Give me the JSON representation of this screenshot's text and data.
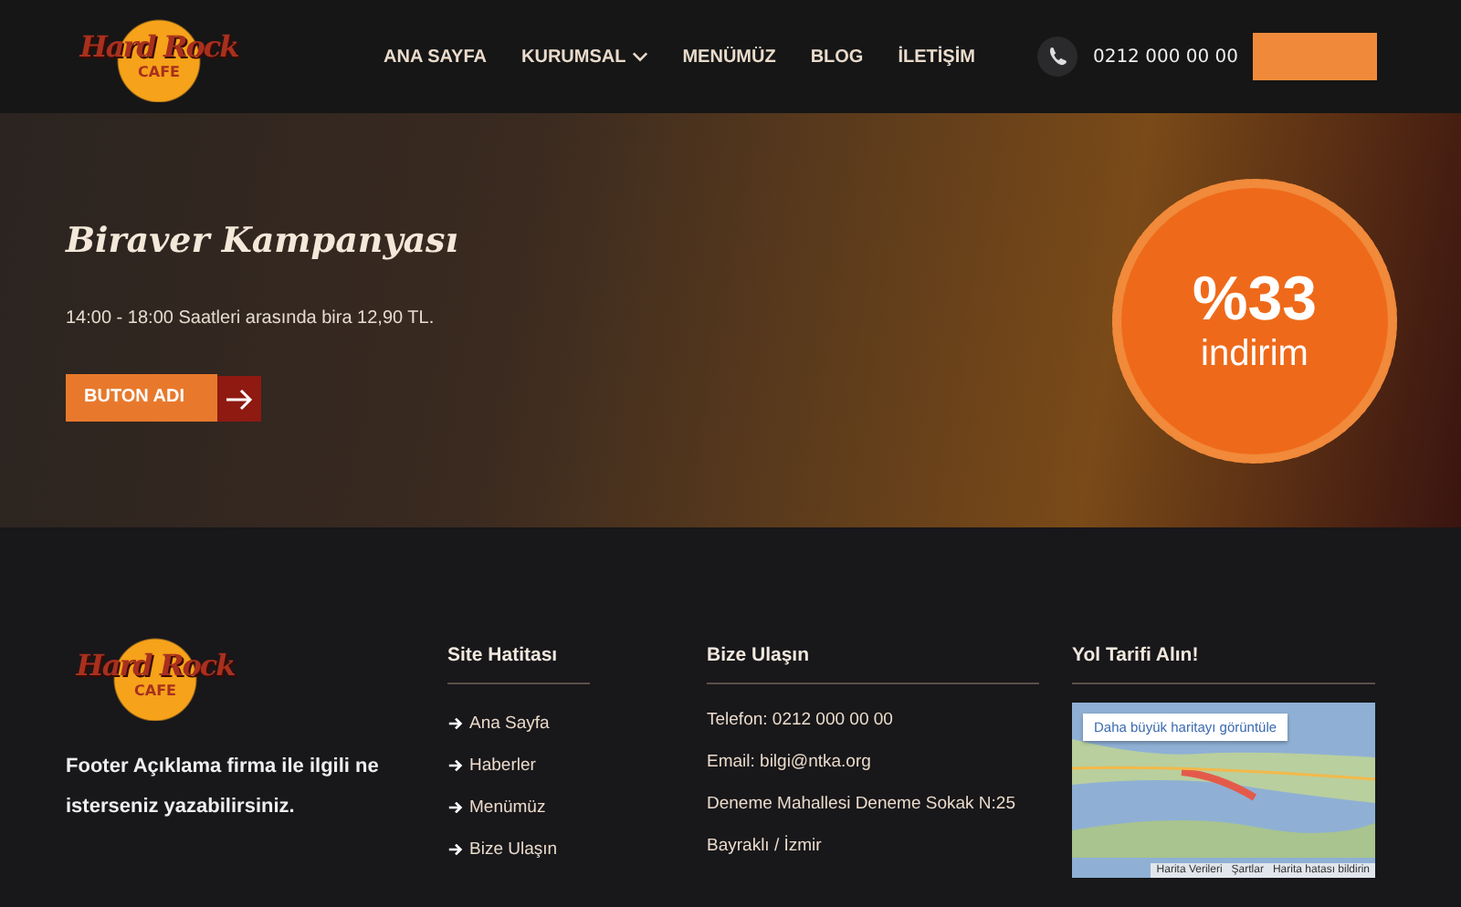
{
  "header": {
    "logo": {
      "top": "Hard Rock",
      "bottom": "CAFE"
    },
    "nav": [
      {
        "label": "ANA SAYFA",
        "dropdown": false
      },
      {
        "label": "KURUMSAL",
        "dropdown": true
      },
      {
        "label": "MENÜMÜZ",
        "dropdown": false
      },
      {
        "label": "BLOG",
        "dropdown": false
      },
      {
        "label": "İLETİŞİM",
        "dropdown": false
      }
    ],
    "phone": "0212 000 00 00"
  },
  "hero": {
    "title": "Biraver Kampanyası",
    "text": "14:00 - 18:00 Saatleri arasında bira 12,90 TL.",
    "button": "BUTON ADI",
    "badge": {
      "value": "%33",
      "label": "indirim"
    }
  },
  "footer": {
    "logo": {
      "top": "Hard Rock",
      "bottom": "CAFE"
    },
    "description": "Footer Açıklama firma ile ilgili ne isterseniz yazabilirsiniz.",
    "sitemap": {
      "title": "Site Hatitası",
      "links": [
        "Ana Sayfa",
        "Haberler",
        "Menümüz",
        "Bize Ulaşın"
      ]
    },
    "contact": {
      "title": "Bize Ulaşın",
      "lines": [
        "Telefon: 0212 000 00 00",
        "Email: bilgi@ntka.org",
        "Deneme Mahallesi Deneme Sokak N:25",
        "Bayraklı / İzmir"
      ]
    },
    "directions": {
      "title": "Yol Tarifi Alın!",
      "map_link": "Daha büyük haritayı görüntüle",
      "map_footer": [
        "Harita Verileri",
        "Şartlar",
        "Harita hatası bildirin"
      ]
    }
  }
}
